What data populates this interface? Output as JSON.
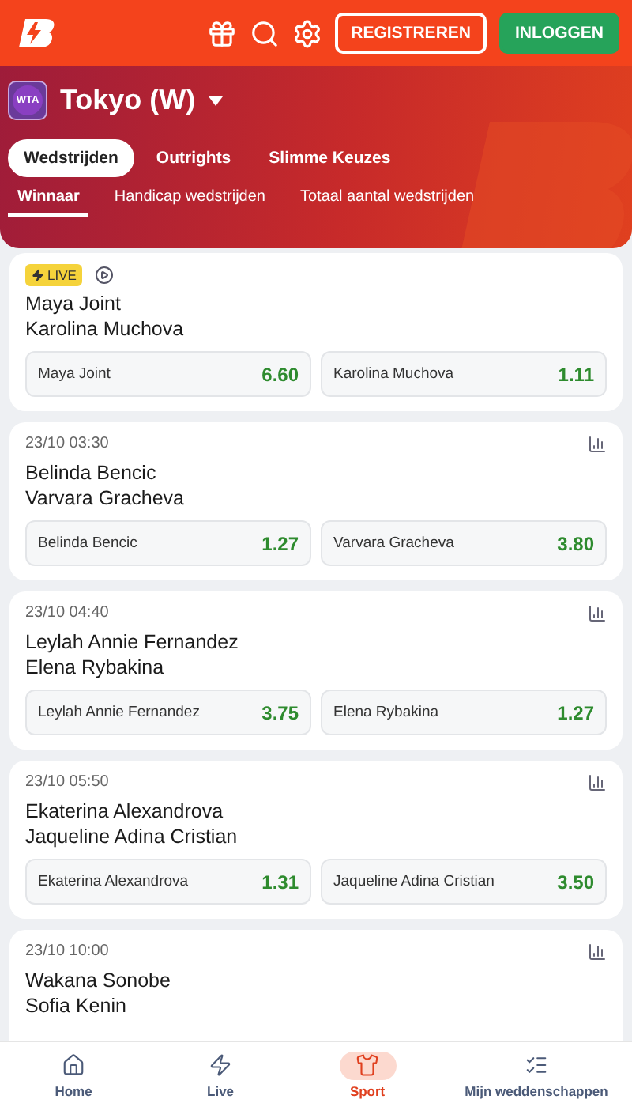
{
  "header": {
    "buttons": [
      {
        "label": "REGISTREREN",
        "kind": "outline"
      },
      {
        "label": "INLOGGEN",
        "kind": "filled"
      }
    ]
  },
  "competition": {
    "badge": "WTA",
    "title": "Tokyo (W)"
  },
  "tabs": [
    {
      "label": "Wedstrijden",
      "selected": true
    },
    {
      "label": "Outrights",
      "selected": false
    },
    {
      "label": "Slimme Keuzes",
      "selected": false
    }
  ],
  "market_tabs": [
    {
      "label": "Winnaar",
      "selected": true
    },
    {
      "label": "Handicap wedstrijden",
      "selected": false
    },
    {
      "label": "Totaal aantal wedstrijden",
      "selected": false
    }
  ],
  "matches": [
    {
      "kind": "live",
      "status": "LIVE",
      "players": [
        "Maya Joint",
        "Karolina Muchova"
      ],
      "odds": [
        {
          "name": "Maya Joint",
          "price": "6.60"
        },
        {
          "name": "Karolina Muchova",
          "price": "1.11"
        }
      ]
    },
    {
      "kind": "scheduled",
      "time": "23/10 03:30",
      "players": [
        "Belinda Bencic",
        "Varvara Gracheva"
      ],
      "odds": [
        {
          "name": "Belinda Bencic",
          "price": "1.27"
        },
        {
          "name": "Varvara Gracheva",
          "price": "3.80"
        }
      ]
    },
    {
      "kind": "scheduled",
      "time": "23/10 04:40",
      "players": [
        "Leylah Annie Fernandez",
        "Elena Rybakina"
      ],
      "odds": [
        {
          "name": "Leylah Annie Fernandez",
          "price": "3.75"
        },
        {
          "name": "Elena Rybakina",
          "price": "1.27"
        }
      ]
    },
    {
      "kind": "scheduled",
      "time": "23/10 05:50",
      "players": [
        "Ekaterina Alexandrova",
        "Jaqueline Adina Cristian"
      ],
      "odds": [
        {
          "name": "Ekaterina Alexandrova",
          "price": "1.31"
        },
        {
          "name": "Jaqueline Adina Cristian",
          "price": "3.50"
        }
      ]
    },
    {
      "kind": "scheduled",
      "time": "23/10 10:00",
      "players": [
        "Wakana Sonobe",
        "Sofia Kenin"
      ]
    }
  ],
  "bottom_nav": [
    {
      "label": "Home",
      "selected": false
    },
    {
      "label": "Live",
      "selected": false
    },
    {
      "label": "Sport",
      "selected": true
    },
    {
      "label": "Mijn weddenschappen",
      "selected": false
    }
  ]
}
